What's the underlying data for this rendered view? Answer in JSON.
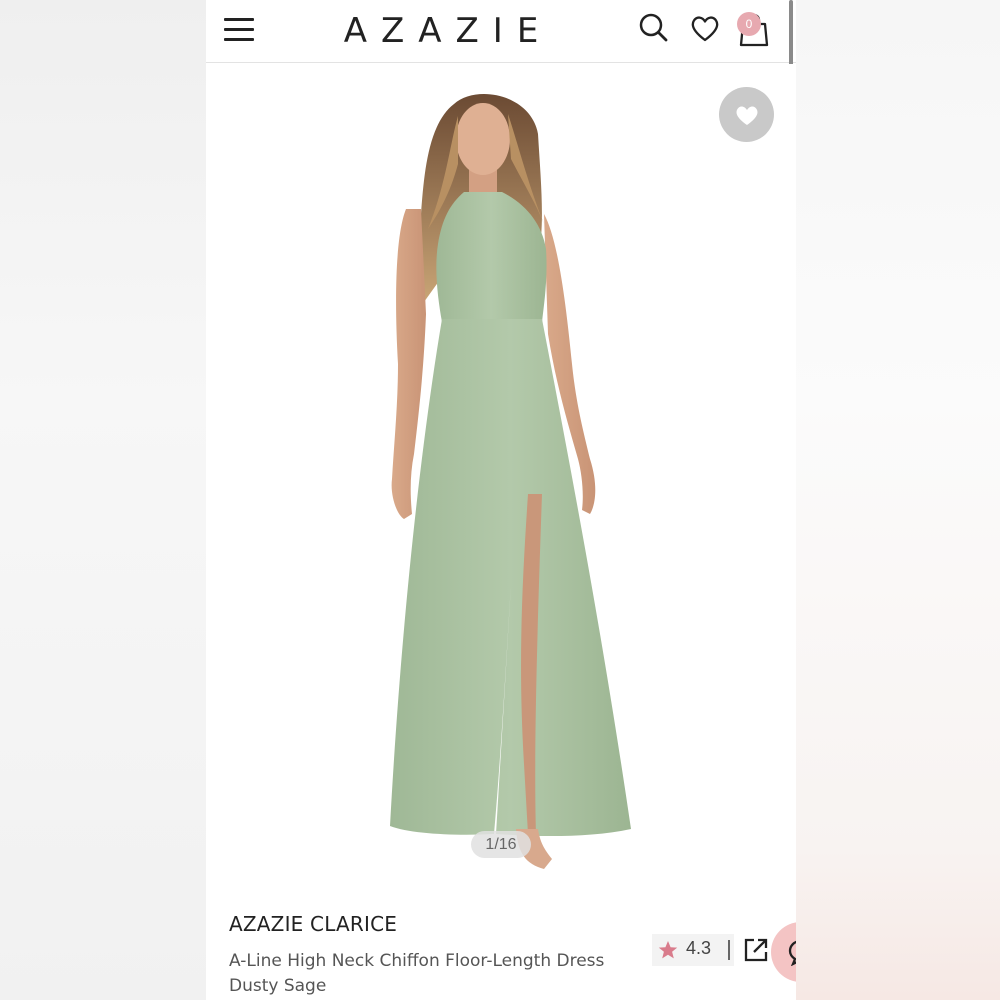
{
  "header": {
    "logo": "AZAZIE",
    "cart_count": "0",
    "icons": [
      "menu-icon",
      "search-icon",
      "heart-icon",
      "shopping-bag-icon"
    ]
  },
  "gallery": {
    "counter": "1/16",
    "dress_color": "#a9c1a0"
  },
  "product": {
    "name": "AZAZIE CLARICE",
    "description": "A-Line High Neck Chiffon Floor-Length Dress",
    "color_name": "Dusty Sage",
    "rating": "4.3"
  },
  "colors": {
    "accent_pink": "#e7a9b0",
    "star_pink": "#d97c8c",
    "chat_pink": "#f4c4c4"
  }
}
